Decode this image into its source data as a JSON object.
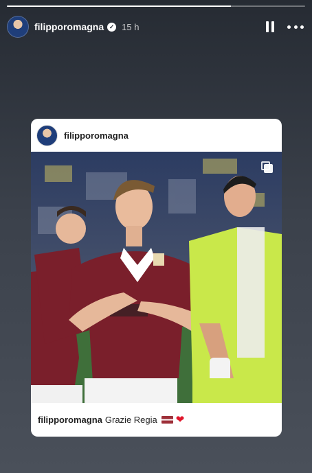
{
  "story": {
    "progress_fraction": 0.75,
    "username": "filipporomagna",
    "verified_mark": "✓",
    "time": "15 h",
    "icons": {
      "pause": "pause-icon",
      "more": "more-options-icon",
      "verified": "verified-badge-icon"
    }
  },
  "post": {
    "username": "filipporomagna",
    "caption_user": "filipporomagna",
    "caption_text": "Grazie Regia",
    "caption_emoji_flag": "latvia-flag",
    "caption_emoji_heart": "❤",
    "multi_image_icon": "carousel-icon"
  },
  "colors": {
    "shirt_maroon": "#7a1f2b",
    "keeper_yellow": "#c9e84a",
    "heart": "#e0162b"
  }
}
